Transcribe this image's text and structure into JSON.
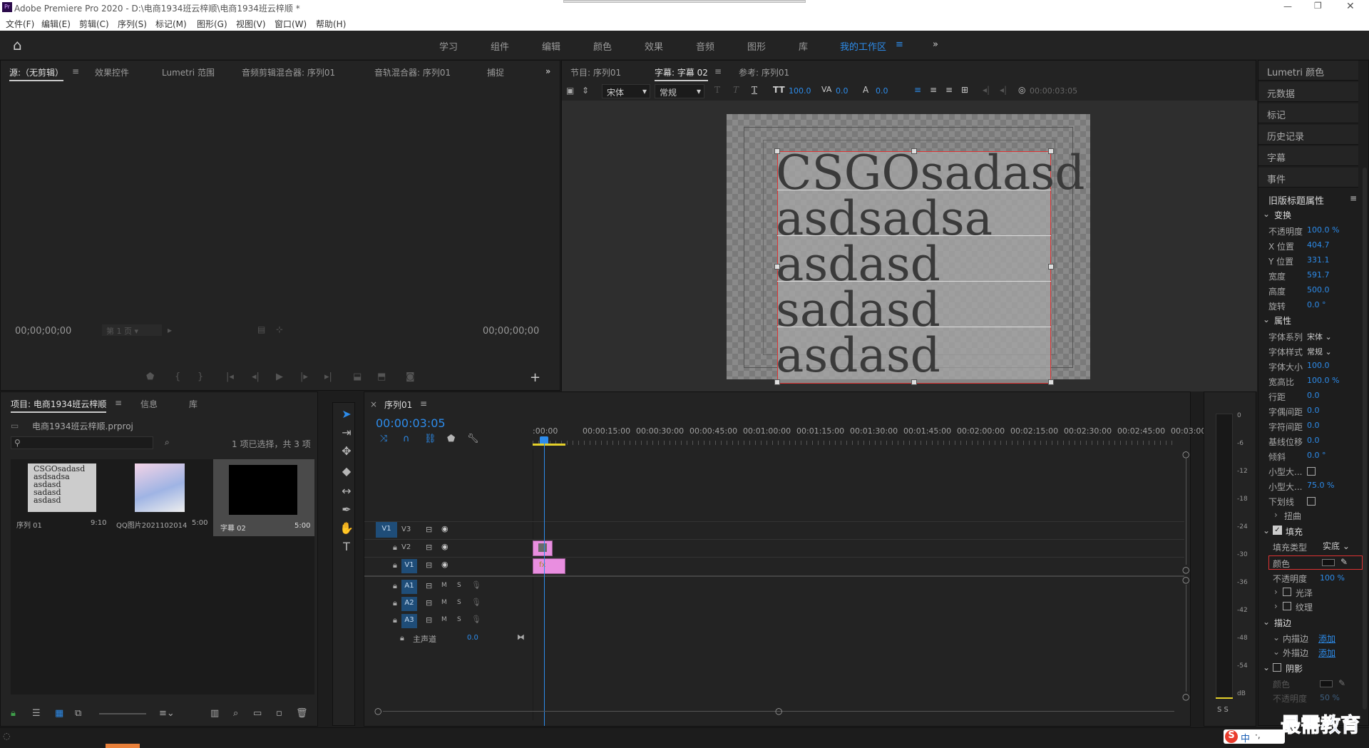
{
  "app": {
    "title": "Adobe Premiere Pro 2020 - D:\\电商1934班云梓顺\\电商1934班云梓顺 *"
  },
  "menu": [
    "文件(F)",
    "编辑(E)",
    "剪辑(C)",
    "序列(S)",
    "标记(M)",
    "图形(G)",
    "视图(V)",
    "窗口(W)",
    "帮助(H)"
  ],
  "workspaces": [
    "学习",
    "组件",
    "编辑",
    "颜色",
    "效果",
    "音频",
    "图形",
    "库",
    "我的工作区"
  ],
  "source_panel": {
    "tabs": [
      "源:（无剪辑）",
      "效果控件",
      "Lumetri 范围",
      "音频剪辑混合器: 序列01",
      "音轨混合器: 序列01",
      "捕捉"
    ],
    "timecode_left": "00;00;00;00",
    "timecode_right": "00;00;00;00",
    "page_select": "第 1 页"
  },
  "program_panel": {
    "tabs": [
      "节目: 序列01",
      "字幕: 字幕 02",
      "参考: 序列01"
    ],
    "font": "宋体",
    "style": "常规",
    "size": "100.0",
    "kerning": "0.0",
    "leading": "0.0",
    "timecode": "00:00:03:05",
    "title_lines": [
      "CSGOsadasd",
      "asdsadsa",
      "asdasd",
      "sadasd",
      "asdasd"
    ]
  },
  "right_sidebar": {
    "buttons": [
      "Lumetri 颜色",
      "元数据",
      "标记",
      "历史记录",
      "字幕",
      "事件"
    ],
    "legacy_title": "旧版标题属性",
    "transform_header": "变换",
    "transform": [
      {
        "label": "不透明度",
        "value": "100.0 %"
      },
      {
        "label": "X 位置",
        "value": "404.7"
      },
      {
        "label": "Y 位置",
        "value": "331.1"
      },
      {
        "label": "宽度",
        "value": "591.7"
      },
      {
        "label": "高度",
        "value": "500.0"
      },
      {
        "label": "旋转",
        "value": "0.0 °"
      }
    ],
    "props_header": "属性",
    "props": [
      {
        "label": "字体系列",
        "value": "宋体"
      },
      {
        "label": "字体样式",
        "value": "常规"
      },
      {
        "label": "字体大小",
        "value": "100.0"
      },
      {
        "label": "宽高比",
        "value": "100.0 %"
      },
      {
        "label": "行距",
        "value": "0.0"
      },
      {
        "label": "字偶间距",
        "value": "0.0"
      },
      {
        "label": "字符间距",
        "value": "0.0"
      },
      {
        "label": "基线位移",
        "value": "0.0"
      },
      {
        "label": "倾斜",
        "value": "0.0 °"
      },
      {
        "label": "小型大...",
        "value": ""
      },
      {
        "label": "小型大...",
        "value": "75.0 %"
      },
      {
        "label": "下划线",
        "value": ""
      }
    ],
    "distort": "扭曲",
    "fill_header": "填充",
    "fill_type_label": "填充类型",
    "fill_type_value": "实底",
    "color_label": "颜色",
    "fill_opacity_label": "不透明度",
    "fill_opacity_value": "100 %",
    "sheen": "光泽",
    "texture": "纹理",
    "stroke_header": "描边",
    "inner_stroke": "内描边",
    "outer_stroke": "外描边",
    "add": "添加",
    "shadow_header": "阴影",
    "shadow_color": "颜色",
    "shadow_opacity_label": "不透明度",
    "shadow_opacity_value": "50 %"
  },
  "project_panel": {
    "tabs": [
      "项目: 电商1934班云梓顺",
      "信息",
      "库"
    ],
    "file": "电商1934班云梓顺.prproj",
    "selection": "1 项已选择，共 3 项",
    "items": [
      {
        "name": "序列 01",
        "duration": "9:10"
      },
      {
        "name": "QQ图片2021102014...",
        "duration": "5:00"
      },
      {
        "name": "字幕 02",
        "duration": "5:00"
      }
    ],
    "thumb_text": [
      "CSGOsadasd",
      "asdsadsa",
      "asdasd",
      "sadasd",
      "asdasd"
    ]
  },
  "timeline": {
    "tab": "序列01",
    "timecode": "00:00:03:05",
    "ruler": [
      ":00:00",
      "00:00:15:00",
      "00:00:30:00",
      "00:00:45:00",
      "00:01:00:00",
      "00:01:15:00",
      "00:01:30:00",
      "00:01:45:00",
      "00:02:00:00",
      "00:02:15:00",
      "00:02:30:00",
      "00:02:45:00",
      "00:03:00"
    ],
    "video_tracks": [
      "V3",
      "V2",
      "V1"
    ],
    "source_patch": "V1",
    "audio_tracks": [
      "A1",
      "A2",
      "A3"
    ],
    "master_label": "主声道",
    "master_value": "0.0",
    "m": "M",
    "s": "S"
  },
  "meter": {
    "scale": [
      "0",
      "-6",
      "-12",
      "-18",
      "-24",
      "-30",
      "-36",
      "-42",
      "-48",
      "-54",
      "dB"
    ],
    "solo": "S S"
  },
  "taskbar": {
    "ime": "中",
    "watermark": "最需教育"
  },
  "colors": {
    "accent": "#2d8ceb",
    "clip_pink": "#e98ee0",
    "patch_blue": "#1f4d78"
  }
}
